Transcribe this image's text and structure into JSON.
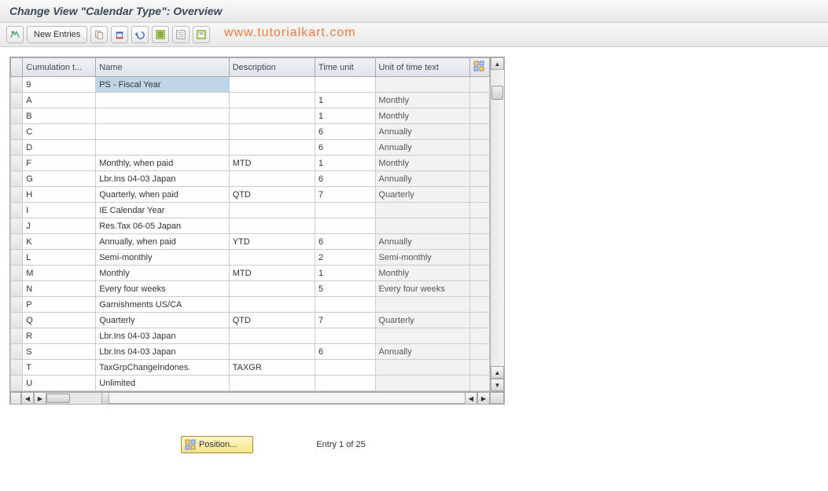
{
  "title": "Change View \"Calendar Type\": Overview",
  "toolbar": {
    "new_entries": "New Entries"
  },
  "watermark": "www.tutorialkart.com",
  "columns": {
    "cumul": "Cumulation t...",
    "name": "Name",
    "desc": "Description",
    "time": "Time unit",
    "unit": "Unit of time text"
  },
  "rows": [
    {
      "c": "9",
      "n": "PS - Fiscal Year",
      "d": "",
      "t": "",
      "u": "",
      "sel": true
    },
    {
      "c": "A",
      "n": "",
      "d": "",
      "t": "1",
      "u": "Monthly"
    },
    {
      "c": "B",
      "n": "",
      "d": "",
      "t": "1",
      "u": "Monthly"
    },
    {
      "c": "C",
      "n": "",
      "d": "",
      "t": "6",
      "u": "Annually"
    },
    {
      "c": "D",
      "n": "",
      "d": "",
      "t": "6",
      "u": "Annually"
    },
    {
      "c": "F",
      "n": "Monthly, when paid",
      "d": "MTD",
      "t": "1",
      "u": "Monthly"
    },
    {
      "c": "G",
      "n": "Lbr.Ins 04-03  Japan",
      "d": "",
      "t": "6",
      "u": "Annually"
    },
    {
      "c": "H",
      "n": "Quarterly, when paid",
      "d": "QTD",
      "t": "7",
      "u": "Quarterly"
    },
    {
      "c": "I",
      "n": "IE Calendar Year",
      "d": "",
      "t": "",
      "u": ""
    },
    {
      "c": "J",
      "n": "Res.Tax 06-05  Japan",
      "d": "",
      "t": "",
      "u": ""
    },
    {
      "c": "K",
      "n": "Annually, when paid",
      "d": "YTD",
      "t": "6",
      "u": "Annually"
    },
    {
      "c": "L",
      "n": "Semi-monthly",
      "d": "",
      "t": "2",
      "u": "Semi-monthly"
    },
    {
      "c": "M",
      "n": "Monthly",
      "d": "MTD",
      "t": "1",
      "u": "Monthly"
    },
    {
      "c": "N",
      "n": "Every four weeks",
      "d": "",
      "t": "5",
      "u": "Every four weeks"
    },
    {
      "c": "P",
      "n": "Garnishments US/CA",
      "d": "",
      "t": "",
      "u": ""
    },
    {
      "c": "Q",
      "n": "Quarterly",
      "d": "QTD",
      "t": "7",
      "u": "Quarterly"
    },
    {
      "c": "R",
      "n": "Lbr.Ins 04-03  Japan",
      "d": "",
      "t": "",
      "u": ""
    },
    {
      "c": "S",
      "n": "Lbr.Ins 04-03  Japan",
      "d": "",
      "t": "6",
      "u": "Annually"
    },
    {
      "c": "T",
      "n": "TaxGrpChangeIndones.",
      "d": "TAXGR",
      "t": "",
      "u": ""
    },
    {
      "c": "U",
      "n": "Unlimited",
      "d": "",
      "t": "",
      "u": ""
    }
  ],
  "position_btn": "Position...",
  "entry_text": "Entry 1 of 25"
}
